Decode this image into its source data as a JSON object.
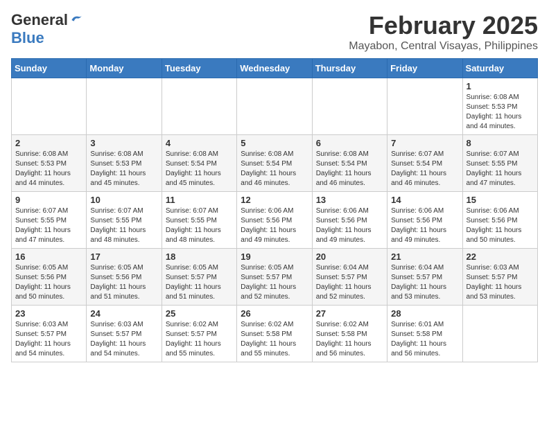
{
  "header": {
    "logo_general": "General",
    "logo_blue": "Blue",
    "month_year": "February 2025",
    "location": "Mayabon, Central Visayas, Philippines"
  },
  "days_of_week": [
    "Sunday",
    "Monday",
    "Tuesday",
    "Wednesday",
    "Thursday",
    "Friday",
    "Saturday"
  ],
  "weeks": [
    [
      {
        "day": "",
        "info": ""
      },
      {
        "day": "",
        "info": ""
      },
      {
        "day": "",
        "info": ""
      },
      {
        "day": "",
        "info": ""
      },
      {
        "day": "",
        "info": ""
      },
      {
        "day": "",
        "info": ""
      },
      {
        "day": "1",
        "info": "Sunrise: 6:08 AM\nSunset: 5:53 PM\nDaylight: 11 hours\nand 44 minutes."
      }
    ],
    [
      {
        "day": "2",
        "info": "Sunrise: 6:08 AM\nSunset: 5:53 PM\nDaylight: 11 hours\nand 44 minutes."
      },
      {
        "day": "3",
        "info": "Sunrise: 6:08 AM\nSunset: 5:53 PM\nDaylight: 11 hours\nand 45 minutes."
      },
      {
        "day": "4",
        "info": "Sunrise: 6:08 AM\nSunset: 5:54 PM\nDaylight: 11 hours\nand 45 minutes."
      },
      {
        "day": "5",
        "info": "Sunrise: 6:08 AM\nSunset: 5:54 PM\nDaylight: 11 hours\nand 46 minutes."
      },
      {
        "day": "6",
        "info": "Sunrise: 6:08 AM\nSunset: 5:54 PM\nDaylight: 11 hours\nand 46 minutes."
      },
      {
        "day": "7",
        "info": "Sunrise: 6:07 AM\nSunset: 5:54 PM\nDaylight: 11 hours\nand 46 minutes."
      },
      {
        "day": "8",
        "info": "Sunrise: 6:07 AM\nSunset: 5:55 PM\nDaylight: 11 hours\nand 47 minutes."
      }
    ],
    [
      {
        "day": "9",
        "info": "Sunrise: 6:07 AM\nSunset: 5:55 PM\nDaylight: 11 hours\nand 47 minutes."
      },
      {
        "day": "10",
        "info": "Sunrise: 6:07 AM\nSunset: 5:55 PM\nDaylight: 11 hours\nand 48 minutes."
      },
      {
        "day": "11",
        "info": "Sunrise: 6:07 AM\nSunset: 5:55 PM\nDaylight: 11 hours\nand 48 minutes."
      },
      {
        "day": "12",
        "info": "Sunrise: 6:06 AM\nSunset: 5:56 PM\nDaylight: 11 hours\nand 49 minutes."
      },
      {
        "day": "13",
        "info": "Sunrise: 6:06 AM\nSunset: 5:56 PM\nDaylight: 11 hours\nand 49 minutes."
      },
      {
        "day": "14",
        "info": "Sunrise: 6:06 AM\nSunset: 5:56 PM\nDaylight: 11 hours\nand 49 minutes."
      },
      {
        "day": "15",
        "info": "Sunrise: 6:06 AM\nSunset: 5:56 PM\nDaylight: 11 hours\nand 50 minutes."
      }
    ],
    [
      {
        "day": "16",
        "info": "Sunrise: 6:05 AM\nSunset: 5:56 PM\nDaylight: 11 hours\nand 50 minutes."
      },
      {
        "day": "17",
        "info": "Sunrise: 6:05 AM\nSunset: 5:56 PM\nDaylight: 11 hours\nand 51 minutes."
      },
      {
        "day": "18",
        "info": "Sunrise: 6:05 AM\nSunset: 5:57 PM\nDaylight: 11 hours\nand 51 minutes."
      },
      {
        "day": "19",
        "info": "Sunrise: 6:05 AM\nSunset: 5:57 PM\nDaylight: 11 hours\nand 52 minutes."
      },
      {
        "day": "20",
        "info": "Sunrise: 6:04 AM\nSunset: 5:57 PM\nDaylight: 11 hours\nand 52 minutes."
      },
      {
        "day": "21",
        "info": "Sunrise: 6:04 AM\nSunset: 5:57 PM\nDaylight: 11 hours\nand 53 minutes."
      },
      {
        "day": "22",
        "info": "Sunrise: 6:03 AM\nSunset: 5:57 PM\nDaylight: 11 hours\nand 53 minutes."
      }
    ],
    [
      {
        "day": "23",
        "info": "Sunrise: 6:03 AM\nSunset: 5:57 PM\nDaylight: 11 hours\nand 54 minutes."
      },
      {
        "day": "24",
        "info": "Sunrise: 6:03 AM\nSunset: 5:57 PM\nDaylight: 11 hours\nand 54 minutes."
      },
      {
        "day": "25",
        "info": "Sunrise: 6:02 AM\nSunset: 5:57 PM\nDaylight: 11 hours\nand 55 minutes."
      },
      {
        "day": "26",
        "info": "Sunrise: 6:02 AM\nSunset: 5:58 PM\nDaylight: 11 hours\nand 55 minutes."
      },
      {
        "day": "27",
        "info": "Sunrise: 6:02 AM\nSunset: 5:58 PM\nDaylight: 11 hours\nand 56 minutes."
      },
      {
        "day": "28",
        "info": "Sunrise: 6:01 AM\nSunset: 5:58 PM\nDaylight: 11 hours\nand 56 minutes."
      },
      {
        "day": "",
        "info": ""
      }
    ]
  ]
}
